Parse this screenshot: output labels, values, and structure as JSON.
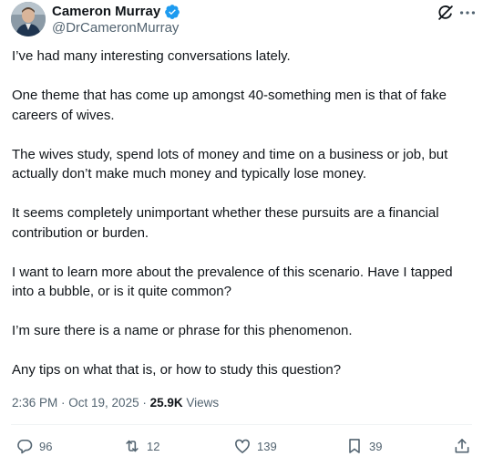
{
  "author": {
    "display_name": "Cameron Murray",
    "handle": "@DrCameronMurray",
    "verified": true
  },
  "tweet": {
    "paragraphs": [
      "I’ve had many interesting conversations lately.",
      "One theme that has come up amongst 40-something men is that of fake careers of wives.",
      "The wives study, spend lots of money and time on a business or job, but actually don’t make much money and typically lose money.",
      "It seems completely unimportant whether these pursuits are a financial contribution or burden.",
      "I want to learn more about the prevalence of this scenario. Have I tapped into a bubble, or is it quite common?",
      "I’m sure there is a name or phrase for this phenomenon.",
      "Any tips on what that is, or how to study this question?"
    ],
    "time": "2:36 PM",
    "separator": " · ",
    "date": "Oct 19, 2025",
    "views_count": "25.9K",
    "views_label": "Views"
  },
  "actions": {
    "replies": "96",
    "reposts": "12",
    "likes": "139",
    "bookmarks": "39"
  },
  "icons": {
    "verified": "verified-badge-icon",
    "grok": "grok-icon",
    "more": "more-icon",
    "reply": "reply-icon",
    "repost": "repost-icon",
    "like": "heart-icon",
    "bookmark": "bookmark-icon",
    "share": "share-icon"
  },
  "colors": {
    "text": "#0f1419",
    "secondary": "#536471",
    "verified": "#1d9bf0",
    "divider": "#eff3f4"
  }
}
